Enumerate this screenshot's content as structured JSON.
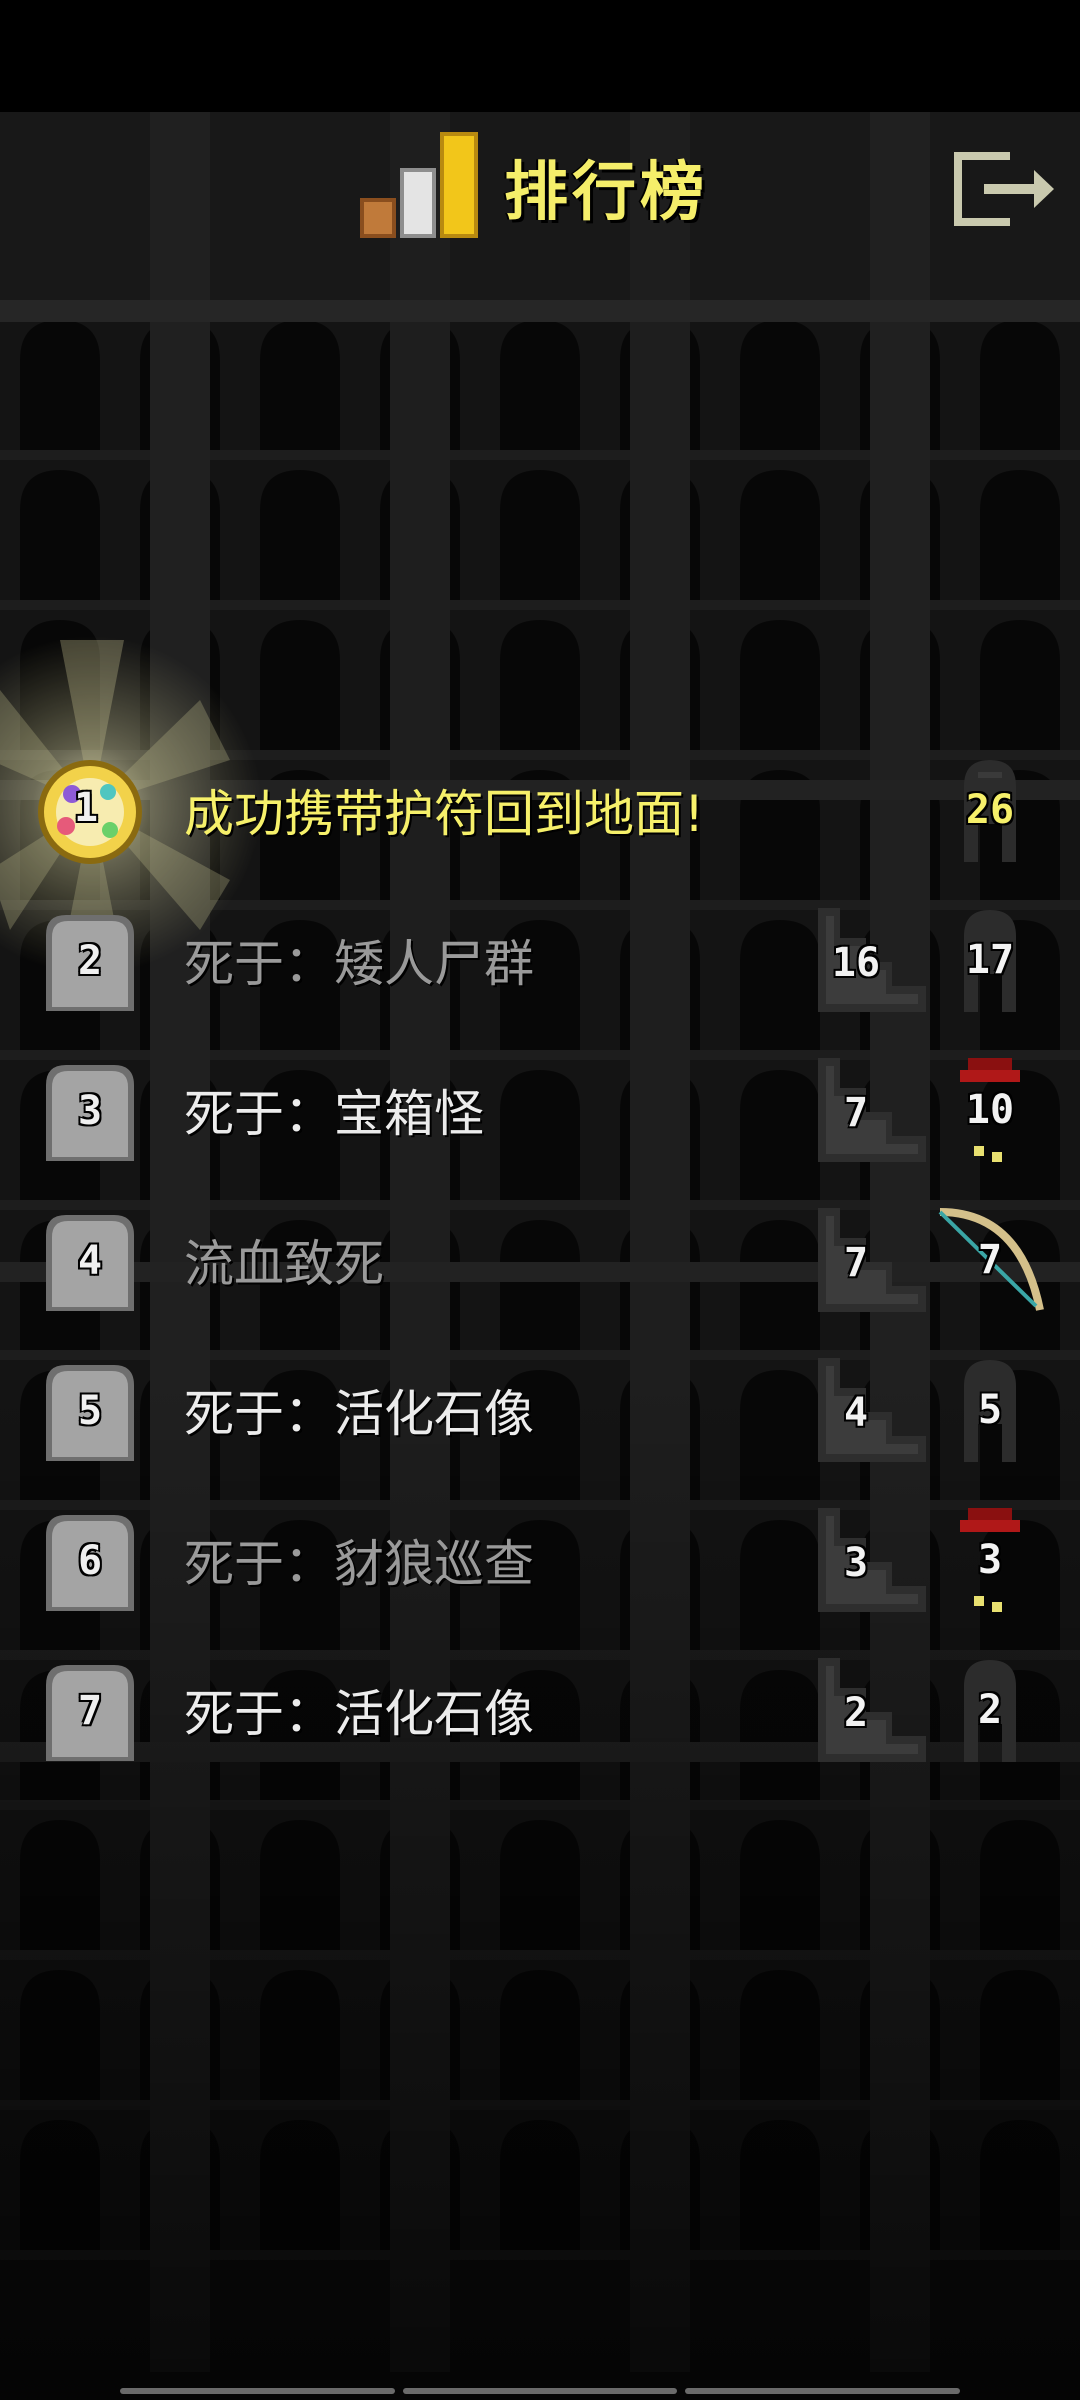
{
  "header": {
    "title": "排行榜",
    "title_icon": "trophy-bars-icon",
    "exit_icon": "exit-door-icon"
  },
  "colors": {
    "title": "#f5ee6a",
    "winner_text": "#f6f06a",
    "normal_text": "#ececec",
    "dim_text": "#9a9a9a",
    "background": "#0a0a0a"
  },
  "records": [
    {
      "rank": "1",
      "description": "成功携带护符回到地面!",
      "depth": "",
      "level": "26",
      "hero_icon": "warrior-helmet-icon",
      "style": "win"
    },
    {
      "rank": "2",
      "description": "死于：矮人尸群",
      "depth": "16",
      "level": "17",
      "hero_icon": "warrior-helmet-icon",
      "style": "dim"
    },
    {
      "rank": "3",
      "description": "死于：宝箱怪",
      "depth": "7",
      "level": "10",
      "hero_icon": "mage-red-hat-icon",
      "style": "normal"
    },
    {
      "rank": "4",
      "description": "流血致死",
      "depth": "7",
      "level": "7",
      "hero_icon": "huntress-bow-icon",
      "style": "dim"
    },
    {
      "rank": "5",
      "description": "死于：活化石像",
      "depth": "4",
      "level": "5",
      "hero_icon": "warrior-helmet-icon",
      "style": "normal"
    },
    {
      "rank": "6",
      "description": "死于：豺狼巡查",
      "depth": "3",
      "level": "3",
      "hero_icon": "mage-red-hat-icon",
      "style": "dim"
    },
    {
      "rank": "7",
      "description": "死于：活化石像",
      "depth": "2",
      "level": "2",
      "hero_icon": "warrior-helmet-icon",
      "style": "normal"
    }
  ]
}
